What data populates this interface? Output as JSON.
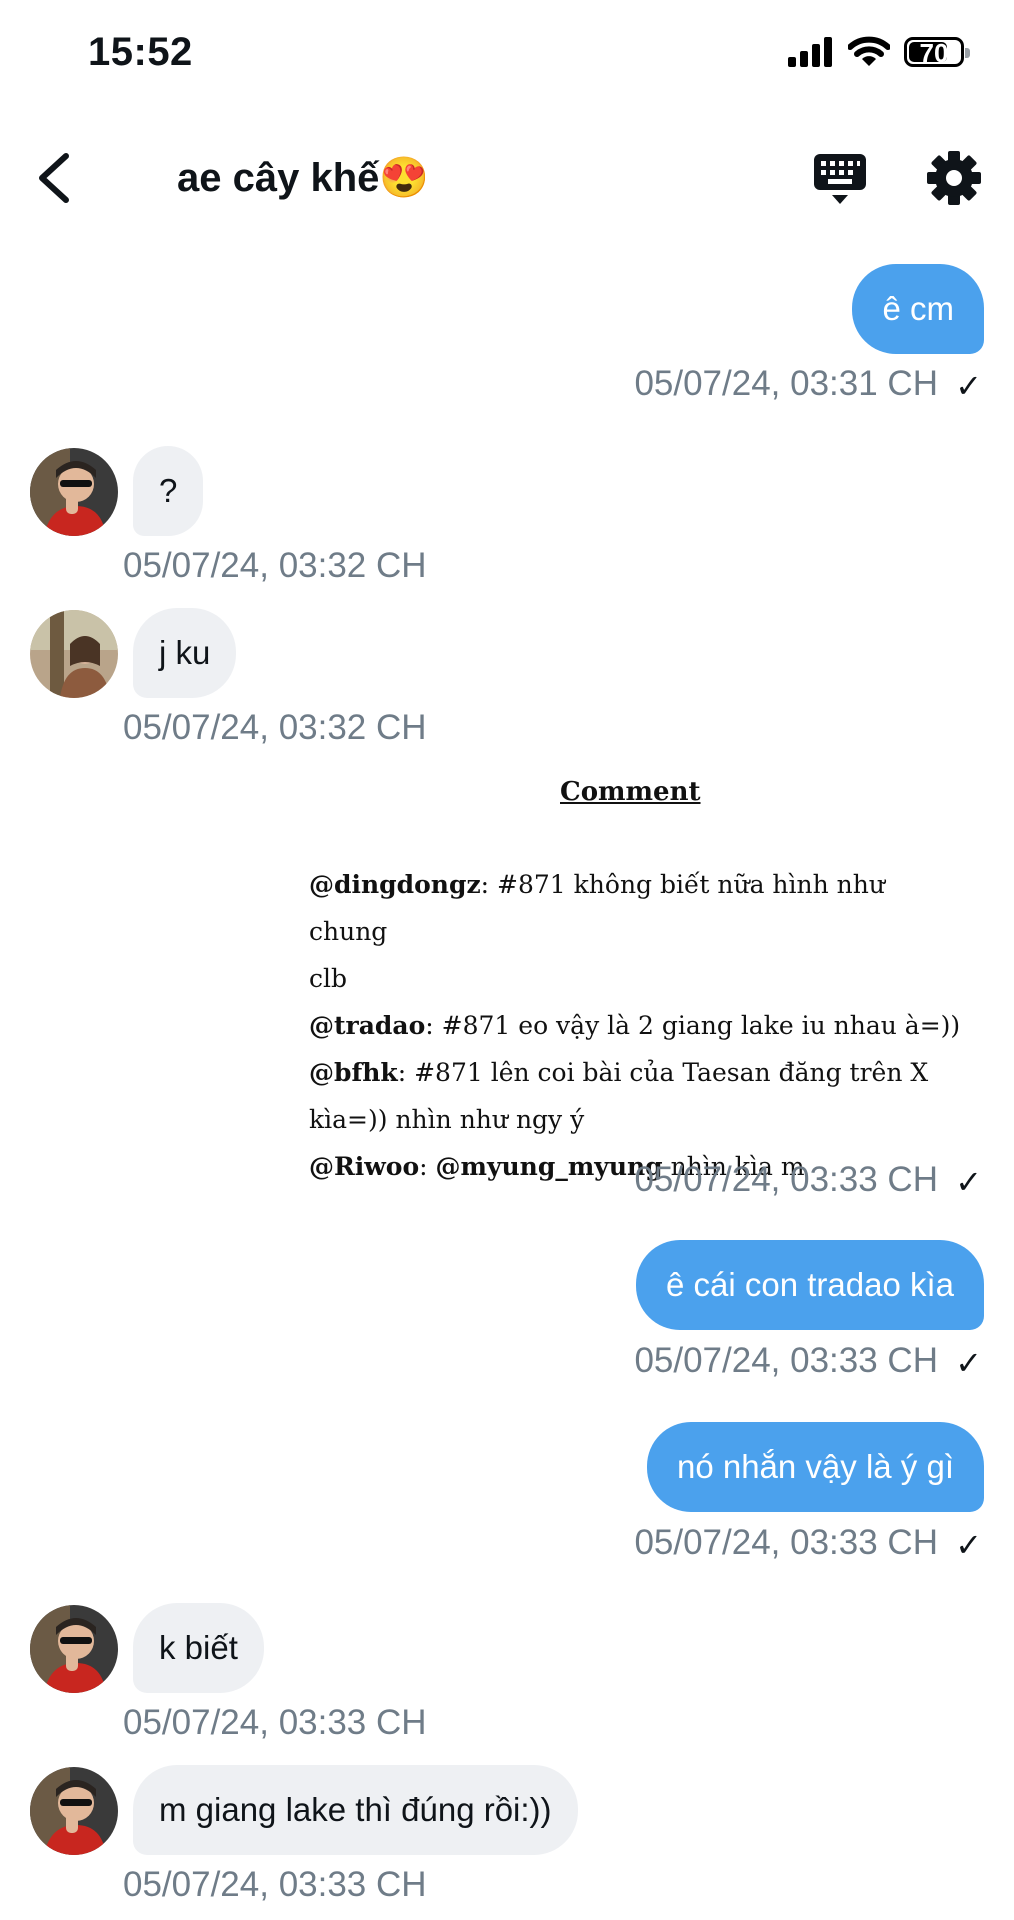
{
  "status_bar": {
    "time": "15:52",
    "battery": "70"
  },
  "header": {
    "title": "ae cây khế😍"
  },
  "messages": [
    {
      "text": "ê cm",
      "timestamp": "05/07/24, 03:31 CH"
    },
    {
      "text": "?",
      "timestamp": "05/07/24, 03:32 CH"
    },
    {
      "text": "j ku",
      "timestamp": "05/07/24, 03:32 CH"
    },
    {
      "timestamp": "05/07/24, 03:33 CH"
    },
    {
      "text": "ê cái con tradao kìa",
      "timestamp": "05/07/24, 03:33 CH"
    },
    {
      "text": "nó nhắn vậy là ý gì",
      "timestamp": "05/07/24, 03:33 CH"
    },
    {
      "text": "k biết",
      "timestamp": "05/07/24, 03:33 CH"
    },
    {
      "text": "m giang lake thì đúng rồi:))",
      "timestamp": "05/07/24, 03:33 CH"
    }
  ],
  "comment_image": {
    "heading": "Comment",
    "lines": [
      {
        "user": "@dingdongz",
        "sep": ": ",
        "text": "#871 không biết nữa hình như chung"
      },
      {
        "user": "",
        "sep": "",
        "text": "clb"
      },
      {
        "user": "@tradao",
        "sep": ": ",
        "text": "#871 eo vậy là 2 giang lake iu nhau à=))"
      },
      {
        "user": "@bfhk",
        "sep": ": ",
        "text": "#871 lên coi bài của Taesan đăng trên X"
      },
      {
        "user": "",
        "sep": "",
        "text": "kìa=)) nhìn như ngy ý"
      },
      {
        "user": "@Riwoo",
        "sep": ": ",
        "mention": "@myung_myung",
        "text": " nhìn kìa m"
      }
    ]
  },
  "colors": {
    "outgoing_bubble": "#4ba1ed",
    "incoming_bubble": "#eef0f3",
    "timestamp": "#6f7c88"
  },
  "icons": [
    "back-arrow-icon",
    "keyboard-icon",
    "gear-icon",
    "cellular-signal-icon",
    "wifi-icon",
    "battery-icon",
    "read-check-icon"
  ]
}
